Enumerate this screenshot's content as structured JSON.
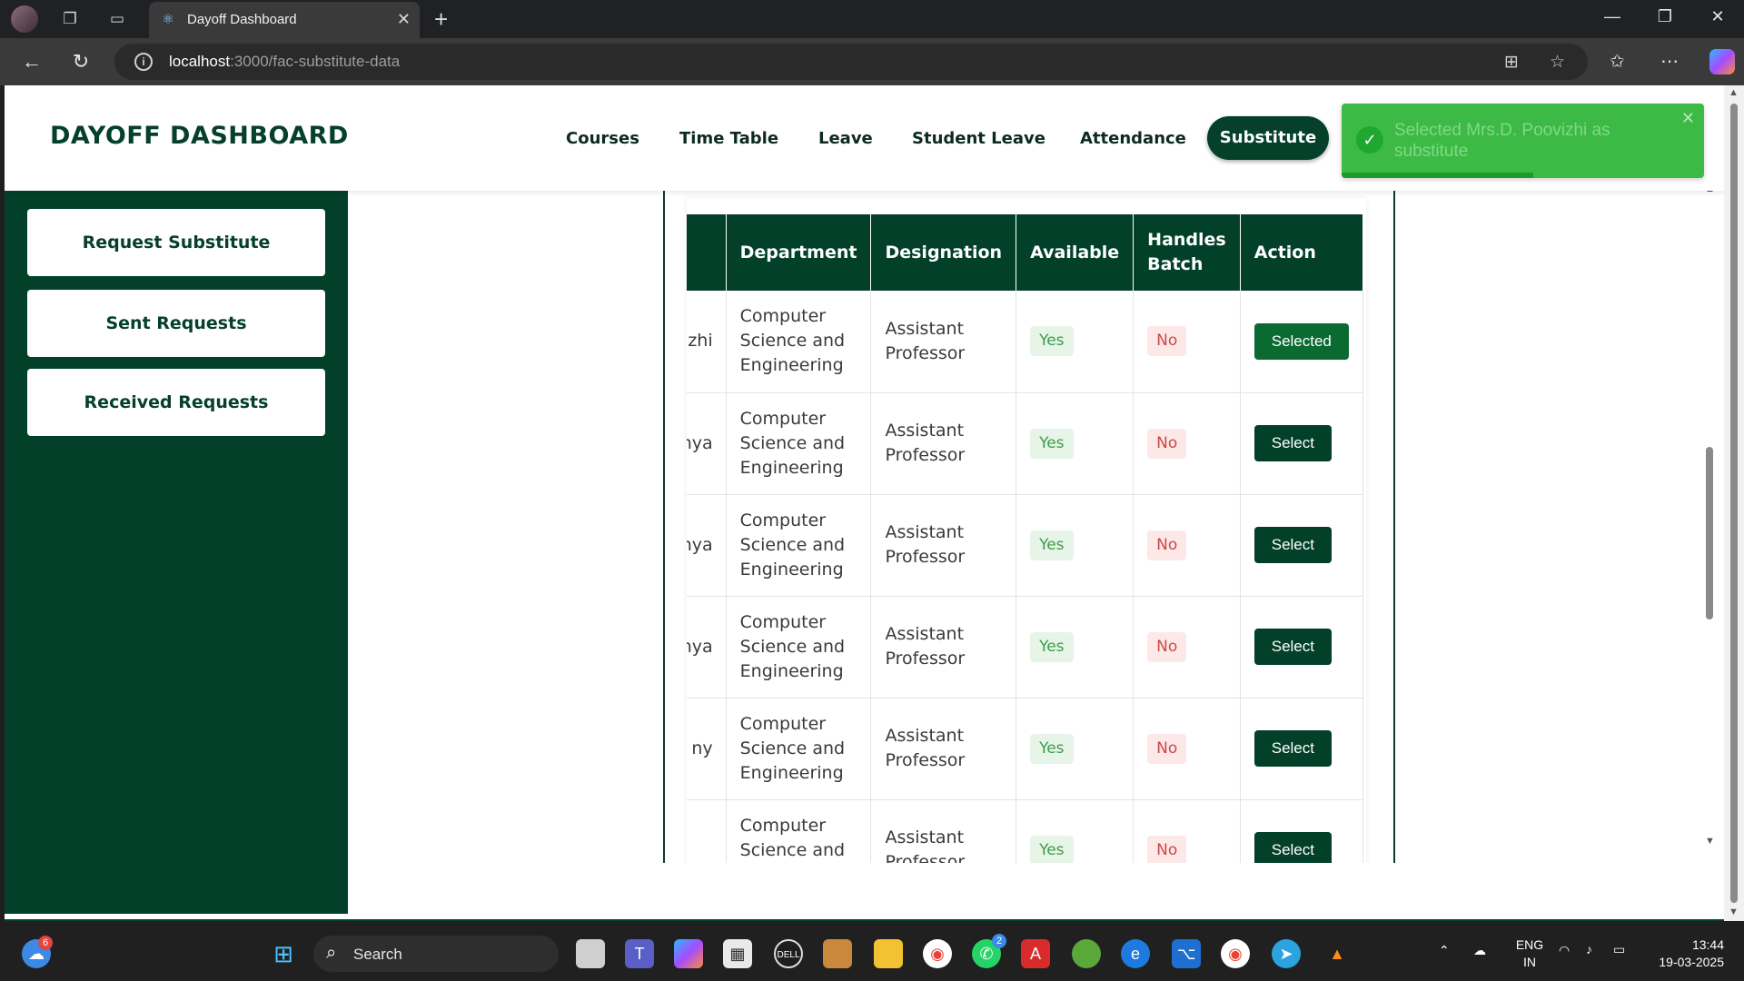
{
  "browser": {
    "tab_title": "Dayoff Dashboard",
    "url_host": "localhost",
    "url_path": ":3000/fac-substitute-data"
  },
  "header": {
    "brand": "DAYOFF DASHBOARD",
    "nav": [
      "Courses",
      "Time Table",
      "Leave",
      "Student Leave",
      "Attendance"
    ],
    "active_nav": "Substitute"
  },
  "toast": {
    "message": "Selected Mrs.D. Poovizhi as substitute",
    "progress_fraction": 0.53
  },
  "sidebar": {
    "items": [
      "Request Substitute",
      "Sent Requests",
      "Received Requests"
    ]
  },
  "table": {
    "headers": [
      "Department",
      "Designation",
      "Available",
      "Handles Batch",
      "Action"
    ],
    "rows": [
      {
        "name": "ovizhi",
        "dept": "Computer Science and Engineering",
        "desg": "Assistant Professor",
        "avail": "Yes",
        "batch": "No",
        "action": "Selected"
      },
      {
        "name": "dhya",
        "dept": "Computer Science and Engineering",
        "desg": "Assistant Professor",
        "avail": "Yes",
        "batch": "No",
        "action": "Select"
      },
      {
        "name": "ganya",
        "dept": "Computer Science and Engineering",
        "desg": "Assistant Professor",
        "avail": "Yes",
        "batch": "No",
        "action": "Select"
      },
      {
        "name": "mya",
        "dept": "Computer Science and Engineering",
        "desg": "Assistant Professor",
        "avail": "Yes",
        "batch": "No",
        "action": "Select"
      },
      {
        "name": "ny",
        "dept": "Computer Science and Engineering",
        "desg": "Assistant Professor",
        "avail": "Yes",
        "batch": "No",
        "action": "Select"
      },
      {
        "name": "",
        "dept": "Computer Science and Engineering",
        "desg": "Assistant Professor",
        "avail": "Yes",
        "batch": "No",
        "action": "Select"
      }
    ]
  },
  "taskbar": {
    "search_label": "Search",
    "weather_badge": "6",
    "whatsapp_badge": "2",
    "lang_line1": "ENG",
    "lang_line2": "IN",
    "time": "13:44",
    "date": "19-03-2025"
  },
  "colors": {
    "primary": "#03402a",
    "toast_bg": "#3dba45",
    "selected_btn": "#0a6a32"
  }
}
